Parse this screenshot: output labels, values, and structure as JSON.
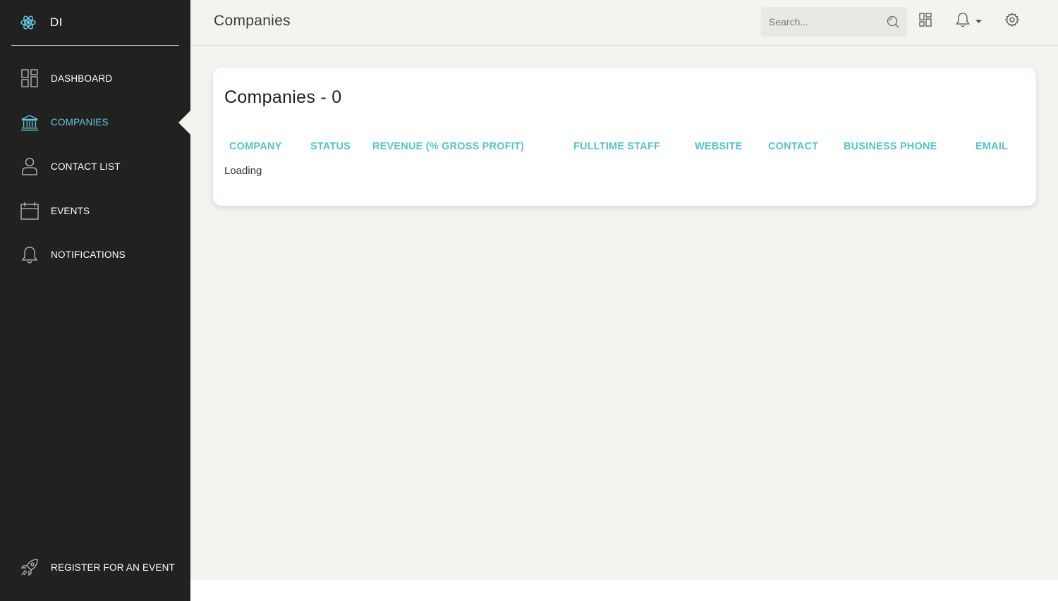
{
  "app": {
    "brand": "DI"
  },
  "sidebar": {
    "items": [
      {
        "label": "DASHBOARD",
        "icon": "dashboard-icon"
      },
      {
        "label": "COMPANIES",
        "icon": "bank-icon",
        "active": true
      },
      {
        "label": "CONTACT LIST",
        "icon": "user-icon"
      },
      {
        "label": "EVENTS",
        "icon": "calendar-icon"
      },
      {
        "label": "NOTIFICATIONS",
        "icon": "bell-icon"
      }
    ],
    "register": {
      "label": "REGISTER FOR AN EVENT",
      "icon": "rocket-icon"
    }
  },
  "header": {
    "title": "Companies",
    "search_placeholder": "Search..."
  },
  "main": {
    "card_title": "Companies - 0",
    "columns": [
      "COMPANY",
      "STATUS",
      "REVENUE (% GROSS PROFIT)",
      "FULLTIME STAFF",
      "WEBSITE",
      "CONTACT",
      "BUSINESS PHONE",
      "EMAIL"
    ],
    "status_text": "Loading"
  },
  "colors": {
    "accent": "#66c6de",
    "table_header": "#5bc2c9",
    "sidebar_bg": "#212120",
    "page_bg": "#f4f3ef"
  }
}
